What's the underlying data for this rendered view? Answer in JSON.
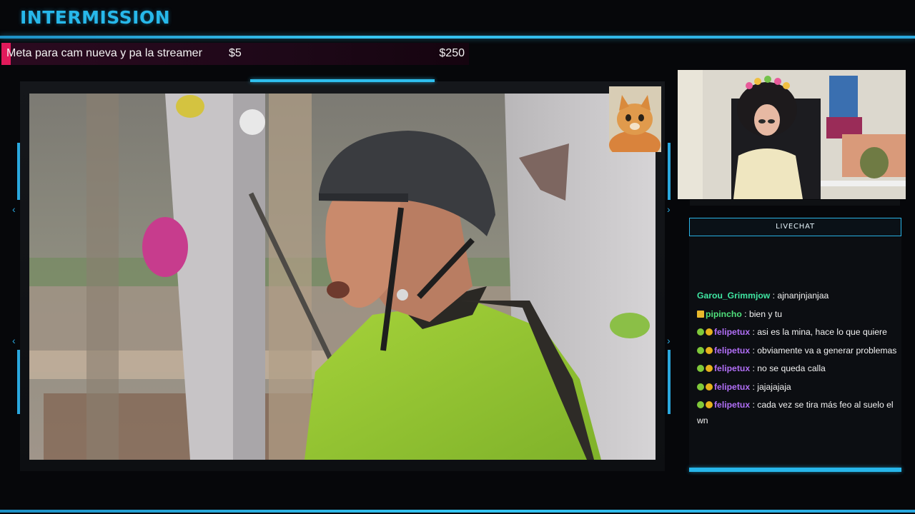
{
  "header": {
    "title": "INTERMISSION"
  },
  "goal": {
    "label": "Meta para cam nueva y pa la streamer",
    "current": "$5",
    "target": "$250",
    "progress": 0.02
  },
  "chat": {
    "header": "LIVECHAT",
    "messages": [
      {
        "user": "Garou_Grimmjow",
        "text": ": ajnanjnjanjaa",
        "color": "#3fe6a2",
        "badges": []
      },
      {
        "user": "pipincho",
        "text": ": bien y tu",
        "color": "#4fe07b",
        "badges": [
          "crown-icon"
        ]
      },
      {
        "user": "felipetux",
        "text": ": asi es la mina, hace lo que quiere",
        "color": "#b06ef5",
        "badges": [
          "cat-badge-icon",
          "coin-badge-icon"
        ]
      },
      {
        "user": "felipetux",
        "text": ": obviamente va a generar problemas",
        "color": "#b06ef5",
        "badges": [
          "cat-badge-icon",
          "coin-badge-icon"
        ]
      },
      {
        "user": "felipetux",
        "text": ": no se queda calla",
        "color": "#b06ef5",
        "badges": [
          "cat-badge-icon",
          "coin-badge-icon"
        ]
      },
      {
        "user": "felipetux",
        "text": ": jajajajaja",
        "color": "#b06ef5",
        "badges": [
          "cat-badge-icon",
          "coin-badge-icon"
        ]
      },
      {
        "user": "felipetux",
        "text": ": cada vez se tira más feo al suelo el wn",
        "color": "#b06ef5",
        "badges": [
          "cat-badge-icon",
          "coin-badge-icon"
        ]
      }
    ]
  },
  "colors": {
    "accent": "#2aa8de",
    "goal_fill": "#e11a5b"
  }
}
